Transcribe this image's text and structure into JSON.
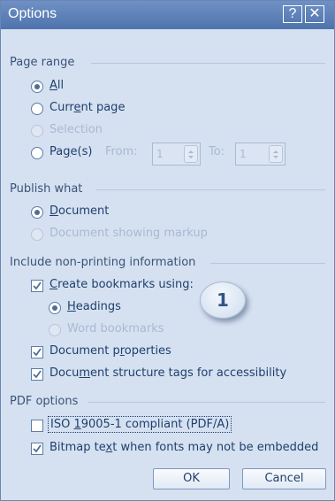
{
  "window": {
    "title": "Options",
    "help_label": "?",
    "close_label": "✕"
  },
  "page_range": {
    "legend": "Page range",
    "all": "All",
    "current_page": "Current page",
    "selection": "Selection",
    "pages": "Page(s)",
    "from_label": "From:",
    "from_value": "1",
    "to_label": "To:",
    "to_value": "1",
    "selected": "All"
  },
  "publish_what": {
    "legend": "Publish what",
    "document": "Document",
    "document_markup": "Document showing markup",
    "selected": "Document"
  },
  "non_printing": {
    "legend": "Include non-printing information",
    "create_bookmarks": "Create bookmarks using:",
    "headings": "Headings",
    "word_bookmarks": "Word bookmarks",
    "document_properties": "Document properties",
    "structure_tags": "Document structure tags for accessibility"
  },
  "pdf_options": {
    "legend": "PDF options",
    "iso": "ISO 19005-1 compliant (PDF/A)",
    "bitmap_text": "Bitmap text when fonts may not be embedded"
  },
  "buttons": {
    "ok": "OK",
    "cancel": "Cancel"
  },
  "callout": {
    "number": "1"
  }
}
